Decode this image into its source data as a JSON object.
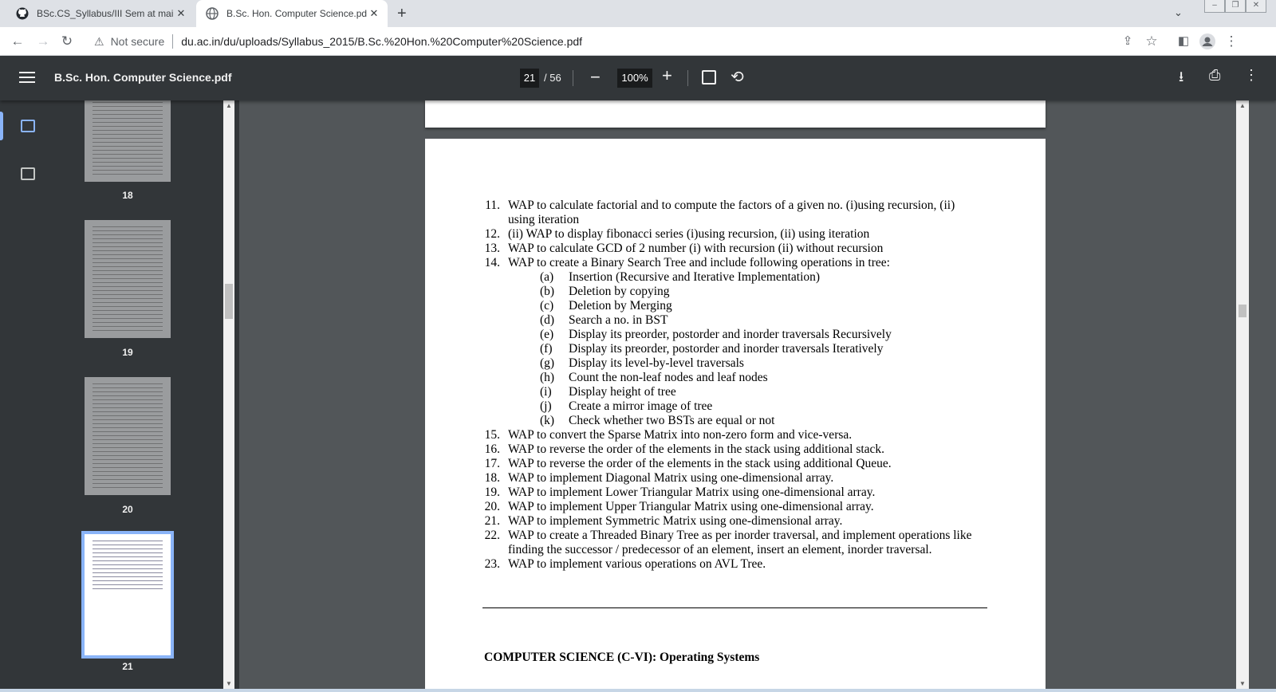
{
  "browser": {
    "tabs": [
      {
        "title": "BSc.CS_Syllabus/III Sem at main",
        "icon": "github-icon",
        "active": false
      },
      {
        "title": "B.Sc. Hon. Computer Science.pdf",
        "icon": "globe-icon",
        "active": true
      }
    ],
    "new_tab": "+",
    "security_label": "Not secure",
    "url": "du.ac.in/du/uploads/Syllabus_2015/B.Sc.%20Hon.%20Computer%20Science.pdf"
  },
  "pdf_toolbar": {
    "title": "B.Sc. Hon. Computer Science.pdf",
    "current_page": "21",
    "total_pages": "/ 56",
    "zoom": "100%"
  },
  "sidebar": {
    "thumbnails": [
      {
        "page": "18",
        "active": false
      },
      {
        "page": "19",
        "active": false
      },
      {
        "page": "20",
        "active": false
      },
      {
        "page": "21",
        "active": true
      }
    ]
  },
  "document": {
    "items": [
      {
        "num": "11.",
        "lines": [
          "WAP to calculate factorial and to compute the factors of a given no. (i)using recursion, (ii)",
          "using iteration"
        ]
      },
      {
        "num": "12.",
        "lines": [
          "(ii) WAP to display fibonacci series (i)using recursion, (ii) using iteration"
        ]
      },
      {
        "num": "13.",
        "lines": [
          "WAP to calculate GCD of 2 number (i) with recursion (ii) without recursion"
        ]
      },
      {
        "num": "14.",
        "lines": [
          "WAP to create a Binary Search Tree and include following operations in tree:"
        ]
      }
    ],
    "subitems": [
      {
        "letter": "(a)",
        "text": "Insertion (Recursive and Iterative Implementation)"
      },
      {
        "letter": "(b)",
        "text": "Deletion by copying"
      },
      {
        "letter": "(c)",
        "text": "Deletion by Merging"
      },
      {
        "letter": "(d)",
        "text": "Search a no. in BST"
      },
      {
        "letter": "(e)",
        "text": "Display its preorder, postorder and inorder traversals Recursively"
      },
      {
        "letter": "(f)",
        "text": "Display its preorder, postorder and inorder traversals Iteratively"
      },
      {
        "letter": "(g)",
        "text": "Display its level-by-level traversals"
      },
      {
        "letter": "(h)",
        "text": "Count the non-leaf nodes and leaf nodes"
      },
      {
        "letter": "(i)",
        "text": "Display height of tree"
      },
      {
        "letter": "(j)",
        "text": "Create a mirror image of tree"
      },
      {
        "letter": "(k)",
        "text": "Check whether two BSTs are equal or not"
      }
    ],
    "items2": [
      {
        "num": "15.",
        "lines": [
          "WAP to convert the Sparse Matrix into non-zero form and vice-versa."
        ]
      },
      {
        "num": "16.",
        "lines": [
          "WAP to reverse the order of the elements in the stack using additional stack."
        ]
      },
      {
        "num": "17.",
        "lines": [
          "WAP to reverse the order of the elements in the stack using additional Queue."
        ]
      },
      {
        "num": "18.",
        "lines": [
          "WAP to implement Diagonal Matrix using one-dimensional array."
        ]
      },
      {
        "num": "19.",
        "lines": [
          "WAP to implement Lower Triangular Matrix using one-dimensional array."
        ]
      },
      {
        "num": "20.",
        "lines": [
          "WAP to implement Upper Triangular Matrix using one-dimensional array."
        ]
      },
      {
        "num": "21.",
        "lines": [
          " WAP to implement Symmetric Matrix using one-dimensional array."
        ]
      },
      {
        "num": "22.",
        "lines": [
          "WAP to create a Threaded Binary Tree as per inorder traversal, and implement operations like",
          "finding the successor / predecessor of an element, insert an element, inorder traversal."
        ]
      },
      {
        "num": "23.",
        "lines": [
          "WAP to implement various operations on AVL Tree."
        ]
      }
    ],
    "next_heading": "COMPUTER SCIENCE (C-VI): Operating Systems"
  },
  "colors": {
    "toolbar": "#323639",
    "viewer_bg": "#525659",
    "accent": "#8ab4f8"
  }
}
